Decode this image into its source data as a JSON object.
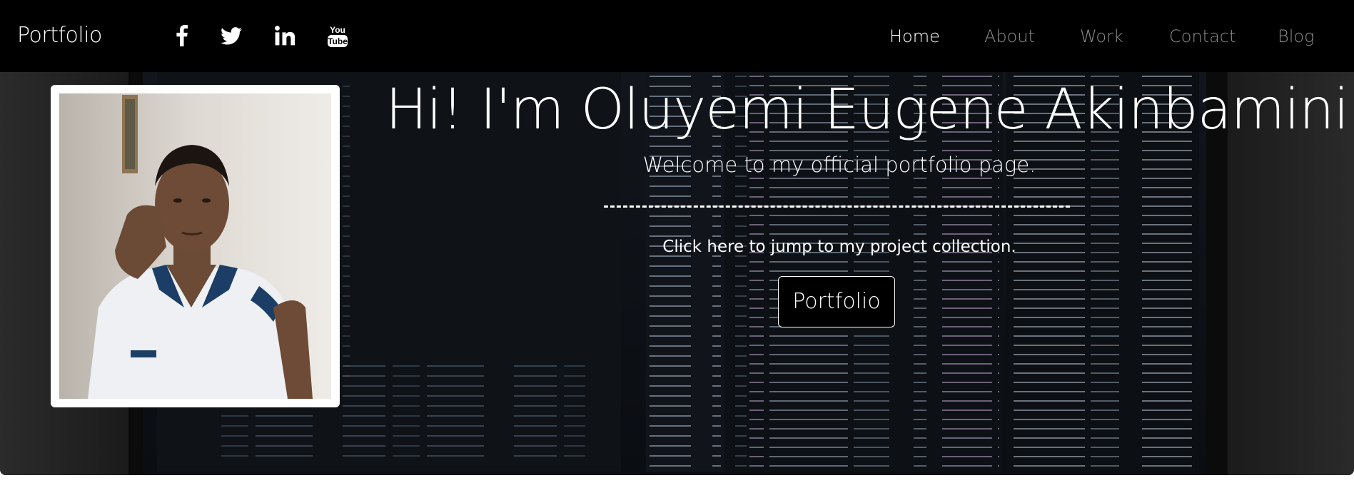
{
  "navbar": {
    "brand": "Portfolio",
    "social": [
      {
        "icon": "facebook-icon"
      },
      {
        "icon": "twitter-icon"
      },
      {
        "icon": "linkedin-icon"
      },
      {
        "icon": "youtube-icon",
        "label_top": "You",
        "label_bottom": "Tube"
      }
    ],
    "links": [
      {
        "label": "Home",
        "active": true
      },
      {
        "label": "About",
        "active": false
      },
      {
        "label": "Work",
        "active": false
      },
      {
        "label": "Contact",
        "active": false
      },
      {
        "label": "Blog",
        "active": false
      }
    ]
  },
  "hero": {
    "title": "Hi! I'm Oluyemi Eugene Akinbamini",
    "subtitle": "Welcome to my official portfolio page.",
    "cta_text": "Click here to jump to my project collection.",
    "button_label": "Portfolio",
    "profile_image": "profile-photo"
  },
  "colors": {
    "navbar_bg": "#000000",
    "nav_active": "#ffffff",
    "nav_inactive": "#8a8a8a",
    "hero_text": "#ffffff",
    "button_bg": "#000000"
  }
}
